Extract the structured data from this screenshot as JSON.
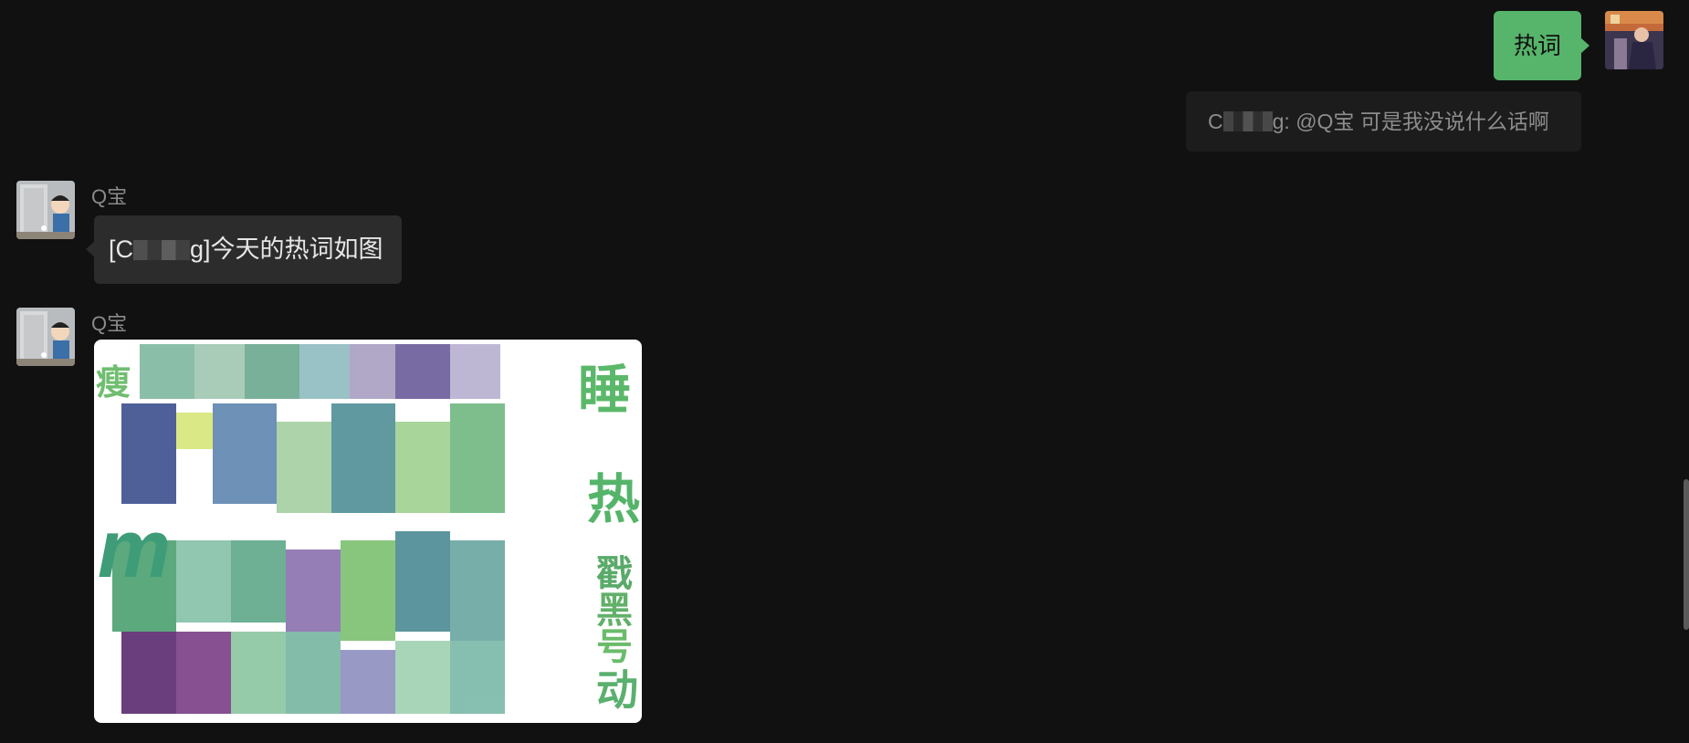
{
  "self_message": {
    "text": "热词",
    "bubble_color": "#56b46b"
  },
  "quote": {
    "prefix": "C",
    "suffix": "g: @Q宝 可是我没说什么话啊"
  },
  "bot": {
    "name": "Q宝",
    "text_prefix": "[C",
    "text_suffix": "g]今天的热词如图",
    "image": {
      "type": "word-cloud",
      "words_visible": [
        "瘦",
        "睡",
        "热",
        "戳",
        "黑",
        "号",
        "动",
        "m"
      ]
    }
  },
  "icons": {
    "self_avatar": "user-avatar-icon",
    "bot_avatar": "bot-avatar-icon"
  }
}
